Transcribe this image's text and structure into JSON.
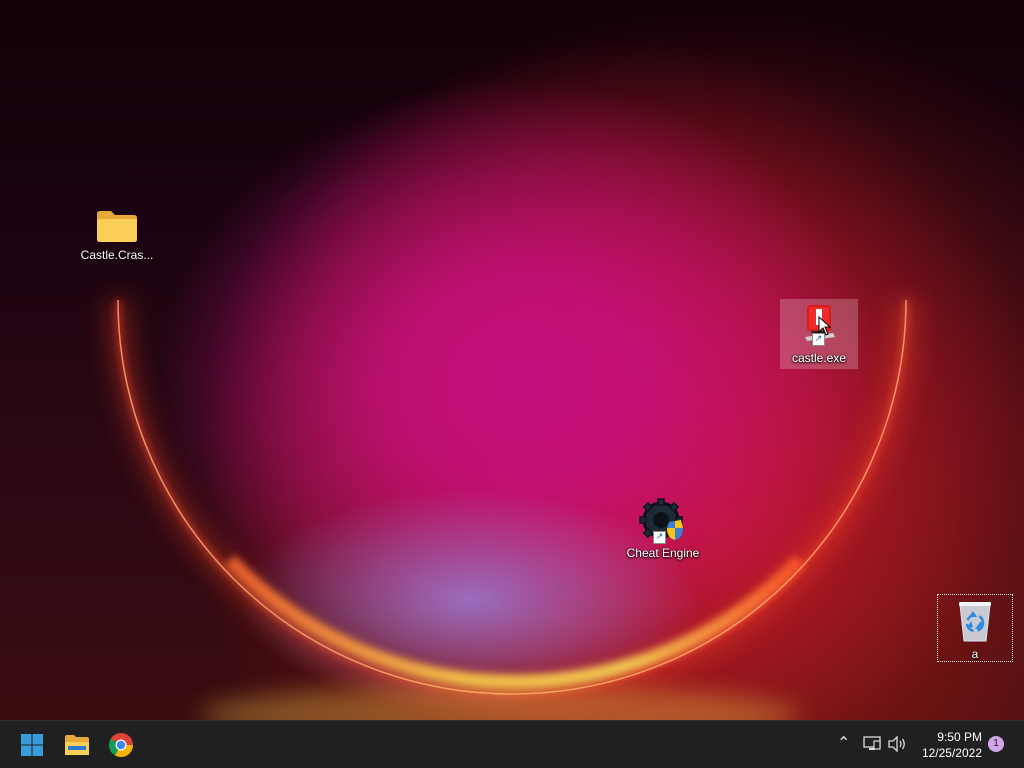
{
  "desktop": {
    "icons": [
      {
        "label": "Castle.Cras...",
        "icon": "folder-icon"
      },
      {
        "label": "castle.exe",
        "icon": "castle-crashers-icon",
        "shortcut": true
      },
      {
        "label": "Cheat Engine",
        "icon": "cheat-engine-icon",
        "shortcut": true
      },
      {
        "label": "a",
        "icon": "recycle-bin-icon"
      }
    ]
  },
  "taskbar": {
    "pinned": [
      {
        "name": "start",
        "icon": "windows-logo-icon"
      },
      {
        "name": "file-explorer",
        "icon": "file-explorer-icon"
      },
      {
        "name": "chrome",
        "icon": "chrome-icon"
      }
    ],
    "tray": {
      "time": "9:50 PM",
      "date": "12/25/2022",
      "notification_count": "1"
    }
  },
  "colors": {
    "taskbar_bg": "#202020",
    "folder_yellow": "#f7c948",
    "windows_blue": "#3a9bdc"
  }
}
